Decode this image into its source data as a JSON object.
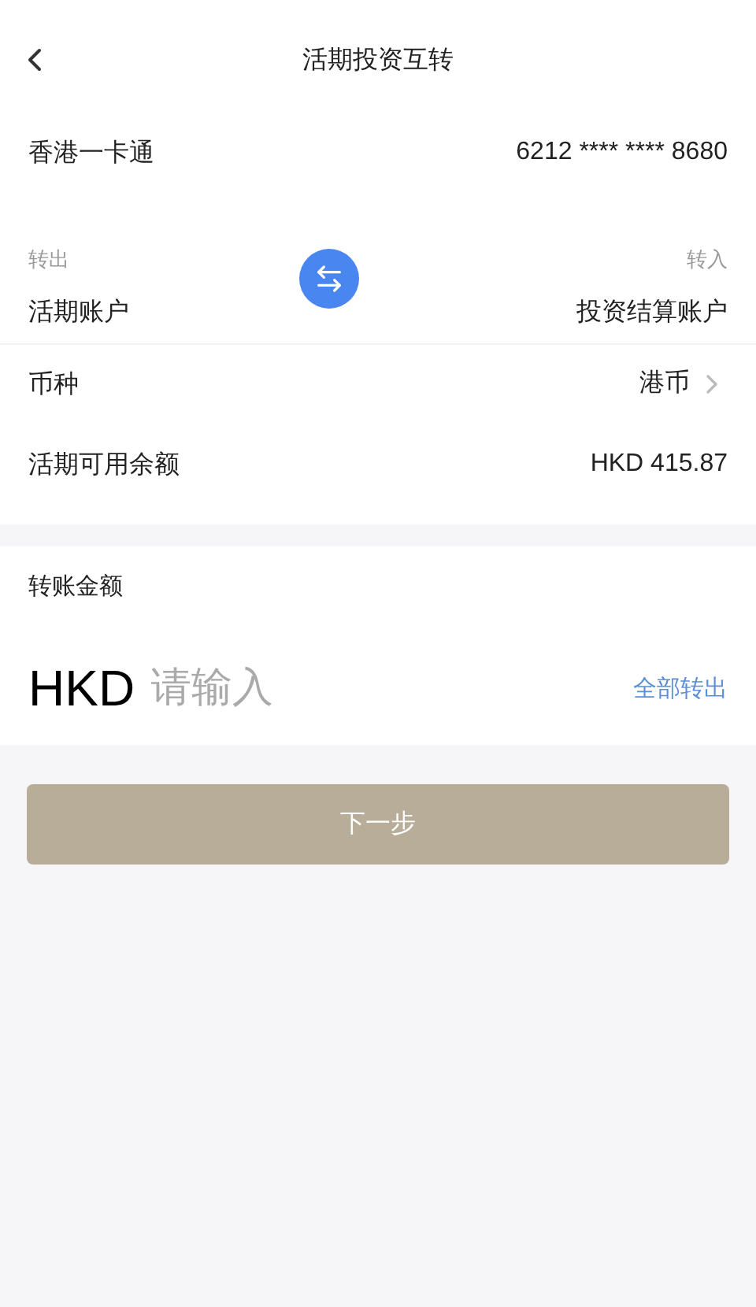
{
  "header": {
    "title": "活期投资互转"
  },
  "card": {
    "name": "香港一卡通",
    "number": "6212 **** **** 8680"
  },
  "transfer": {
    "from_label": "转出",
    "from_account": "活期账户",
    "to_label": "转入",
    "to_account": "投资结算账户"
  },
  "rows": [
    {
      "kind": "link",
      "label": "币种",
      "value": "港币"
    },
    {
      "kind": "plain",
      "label": "活期可用余额",
      "value": "HKD 415.87"
    }
  ],
  "amount": {
    "label": "转账金额",
    "currency": "HKD",
    "placeholder": "请输入",
    "all_link": "全部转出"
  },
  "next_button": {
    "label": "下一步",
    "disabled": true
  }
}
